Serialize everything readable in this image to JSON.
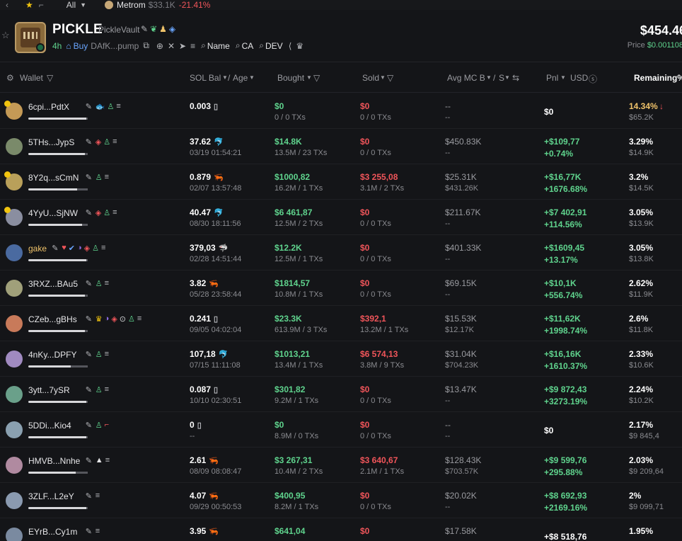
{
  "topstrip": {
    "all_label": "All",
    "token_name": "Metrom",
    "token_mc": "$33.1K",
    "token_change": "-21.41%"
  },
  "token": {
    "name": "PICKLE",
    "subname": "PickleVault",
    "age": "4h",
    "buy_label": "Buy",
    "ca_short": "DAfK...pump",
    "search_name": "Name",
    "search_ca": "CA",
    "search_dev": "DEV",
    "price_big": "$454.46",
    "price_label": "Price",
    "price_value": "$0.001108"
  },
  "headers": {
    "wallet": "Wallet",
    "sol_bal": "SOL Bal",
    "age": "Age",
    "bought": "Bought",
    "sold": "Sold",
    "avg_mc": "Avg MC B",
    "avg_mc_s": "S",
    "pnl": "Pnl",
    "usd": "USD",
    "remaining": "Remaining%"
  },
  "rows": [
    {
      "wallet": "6cpi...PdtX",
      "sol": "0.003",
      "sol_icon": "▯",
      "time": "",
      "bought": "$0",
      "bought_tx": "0 / 0 TXs",
      "sold": "$0",
      "sold_tx": "0 / 0 TXs",
      "mcb": "--",
      "mcs": "--",
      "pnl": "$0",
      "pnl_pct": "",
      "rem": "14.34%",
      "rem_usd": "$65.2K"
    },
    {
      "wallet": "5THs...JypS",
      "sol": "37.62",
      "sol_icon": "🐬",
      "time": "03/19 01:54:21",
      "bought": "$14.8K",
      "bought_tx": "13.5M / 23 TXs",
      "sold": "$0",
      "sold_tx": "0 / 0 TXs",
      "mcb": "$450.83K",
      "mcs": "--",
      "pnl": "+$109,77",
      "pnl_pct": "+0.74%",
      "rem": "3.29%",
      "rem_usd": "$14.9K"
    },
    {
      "wallet": "8Y2q...sCmN",
      "sol": "0.879",
      "sol_icon": "🦐",
      "time": "02/07 13:57:48",
      "bought": "$1000,82",
      "bought_tx": "16.2M / 1 TXs",
      "sold": "$3 255,08",
      "sold_tx": "3.1M / 2 TXs",
      "mcb": "$25.31K",
      "mcs": "$431.26K",
      "pnl": "+$16,77K",
      "pnl_pct": "+1676.68%",
      "rem": "3.2%",
      "rem_usd": "$14.5K"
    },
    {
      "wallet": "4YyU...SjNW",
      "sol": "40.47",
      "sol_icon": "🐬",
      "time": "08/30 18:11:56",
      "bought": "$6 461,87",
      "bought_tx": "12.5M / 2 TXs",
      "sold": "$0",
      "sold_tx": "0 / 0 TXs",
      "mcb": "$211.67K",
      "mcs": "--",
      "pnl": "+$7 402,91",
      "pnl_pct": "+114.56%",
      "rem": "3.05%",
      "rem_usd": "$13.9K"
    },
    {
      "wallet": "gake",
      "sol": "379,03",
      "sol_icon": "🦈",
      "time": "02/28 14:51:44",
      "bought": "$12.2K",
      "bought_tx": "12.5M / 1 TXs",
      "sold": "$0",
      "sold_tx": "0 / 0 TXs",
      "mcb": "$401.33K",
      "mcs": "--",
      "pnl": "+$1609,45",
      "pnl_pct": "+13.17%",
      "rem": "3.05%",
      "rem_usd": "$13.8K"
    },
    {
      "wallet": "3RXZ...BAu5",
      "sol": "3.82",
      "sol_icon": "🦐",
      "time": "05/28 23:58:44",
      "bought": "$1814,57",
      "bought_tx": "10.8M / 1 TXs",
      "sold": "$0",
      "sold_tx": "0 / 0 TXs",
      "mcb": "$69.15K",
      "mcs": "--",
      "pnl": "+$10,1K",
      "pnl_pct": "+556.74%",
      "rem": "2.62%",
      "rem_usd": "$11.9K"
    },
    {
      "wallet": "CZeb...gBHs",
      "sol": "0.241",
      "sol_icon": "▯",
      "time": "09/05 04:02:04",
      "bought": "$23.3K",
      "bought_tx": "613.9M / 3 TXs",
      "sold": "$392,1",
      "sold_tx": "13.2M / 1 TXs",
      "mcb": "$15.53K",
      "mcs": "$12.17K",
      "pnl": "+$11,62K",
      "pnl_pct": "+1998.74%",
      "rem": "2.6%",
      "rem_usd": "$11.8K"
    },
    {
      "wallet": "4nKy...DPFY",
      "sol": "107,18",
      "sol_icon": "🐬",
      "time": "07/15 11:11:08",
      "bought": "$1013,21",
      "bought_tx": "13.4M / 1 TXs",
      "sold": "$6 574,13",
      "sold_tx": "3.8M / 9 TXs",
      "mcb": "$31.04K",
      "mcs": "$704.23K",
      "pnl": "+$16,16K",
      "pnl_pct": "+1610.37%",
      "rem": "2.33%",
      "rem_usd": "$10.6K"
    },
    {
      "wallet": "3ytt...7ySR",
      "sol": "0.087",
      "sol_icon": "▯",
      "time": "10/10 02:30:51",
      "bought": "$301,82",
      "bought_tx": "9.2M / 1 TXs",
      "sold": "$0",
      "sold_tx": "0 / 0 TXs",
      "mcb": "$13.47K",
      "mcs": "--",
      "pnl": "+$9 872,43",
      "pnl_pct": "+3273.19%",
      "rem": "2.24%",
      "rem_usd": "$10.2K"
    },
    {
      "wallet": "5DDi...Kio4",
      "sol": "0",
      "sol_icon": "▯",
      "time": "--",
      "bought": "$0",
      "bought_tx": "8.9M / 0 TXs",
      "sold": "$0",
      "sold_tx": "0 / 0 TXs",
      "mcb": "--",
      "mcs": "--",
      "pnl": "$0",
      "pnl_pct": "",
      "rem": "2.17%",
      "rem_usd": "$9 845,4"
    },
    {
      "wallet": "HMVB...Nnhe",
      "sol": "2.61",
      "sol_icon": "🦐",
      "time": "08/09 08:08:47",
      "bought": "$3 267,31",
      "bought_tx": "10.4M / 2 TXs",
      "sold": "$3 640,67",
      "sold_tx": "2.1M / 1 TXs",
      "mcb": "$128.43K",
      "mcs": "$703.57K",
      "pnl": "+$9 599,76",
      "pnl_pct": "+295.88%",
      "rem": "2.03%",
      "rem_usd": "$9 209,64"
    },
    {
      "wallet": "3ZLF...L2eY",
      "sol": "4.07",
      "sol_icon": "🦐",
      "time": "09/29 00:50:53",
      "bought": "$400,95",
      "bought_tx": "8.2M / 1 TXs",
      "sold": "$0",
      "sold_tx": "0 / 0 TXs",
      "mcb": "$20.02K",
      "mcs": "--",
      "pnl": "+$8 692,93",
      "pnl_pct": "+2169.16%",
      "rem": "2%",
      "rem_usd": "$9 099,71"
    },
    {
      "wallet": "EYrB...Cy1m",
      "sol": "3.95",
      "sol_icon": "🦐",
      "time": "",
      "bought": "$641,04",
      "bought_tx": "",
      "sold": "$0",
      "sold_tx": "",
      "mcb": "$17.58K",
      "mcs": "",
      "pnl": "+$8 518,76",
      "pnl_pct": "",
      "rem": "1.95%",
      "rem_usd": ""
    }
  ],
  "colors": {
    "green": "#5fd38d",
    "red": "#f0555a",
    "accent": "#6aa6ff",
    "orange": "#f0c36a"
  }
}
